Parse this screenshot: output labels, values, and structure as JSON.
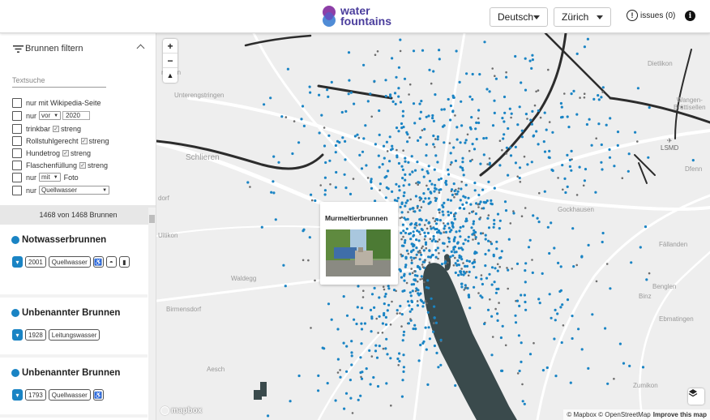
{
  "header": {
    "logo_line1": "water",
    "logo_line2": "fountains",
    "language": "Deutsch",
    "city": "Zürich",
    "issues_label": "issues (0)",
    "info_glyph": "i"
  },
  "filters": {
    "title": "Brunnen filtern",
    "search_placeholder": "Textsuche",
    "wikipedia": "nur mit Wikipedia-Seite",
    "year_prefix": "nur",
    "year_op": "vor",
    "year_value": "2020",
    "potable": "trinkbar",
    "potable_strict": "streng",
    "wheelchair": "Rollstuhlgerecht",
    "wheelchair_strict": "streng",
    "dog": "Hundetrog",
    "dog_strict": "streng",
    "bottle": "Flaschenfüllung",
    "bottle_strict": "streng",
    "photo_prefix": "nur",
    "photo_op": "mit",
    "photo_label": "Foto",
    "water_prefix": "nur",
    "water_type": "Quellwasser"
  },
  "count_text": "1468 von 1468 Brunnen",
  "fountains": [
    {
      "name": "Notwasserbrunnen",
      "year": "2001",
      "water": "Quellwasser"
    },
    {
      "name": "Unbenannter Brunnen",
      "year": "1928",
      "water": "Leitungswasser"
    },
    {
      "name": "Unbenannter Brunnen",
      "year": "1793",
      "water": "Quellwasser"
    }
  ],
  "map": {
    "zoom_in": "+",
    "zoom_out": "−",
    "compass": "▲",
    "popup_title": "Murmeltierbrunnen",
    "labels": {
      "schlieren": "Schlieren",
      "dietlikon": "Dietlikon",
      "wangen": "Wangen-\nBrüttisellen",
      "lsmd": "LSMD",
      "dfenn": "Dfenn",
      "urdorf": "dorf",
      "uitikon": "Uitikon",
      "waldegg": "Waldegg",
      "birmensdorf": "Birmensdorf",
      "gockhausen": "Gockhausen",
      "fallanden": "Fällanden",
      "benglen": "Benglen",
      "binz": "Binz",
      "ebmatingen": "Ebmatingen",
      "aesch": "Aesch",
      "zumikon": "Zumikon",
      "unterengstringen": "Unterengstringen",
      "ningen": "ningen"
    },
    "attribution": "© Mapbox © OpenStreetMap",
    "improve": "Improve this map",
    "mapbox_logo": "mapbox"
  },
  "colors": {
    "fountain_dot": "#1a84c4",
    "lake": "#3a4a4c",
    "accent": "#4a3d9c"
  }
}
